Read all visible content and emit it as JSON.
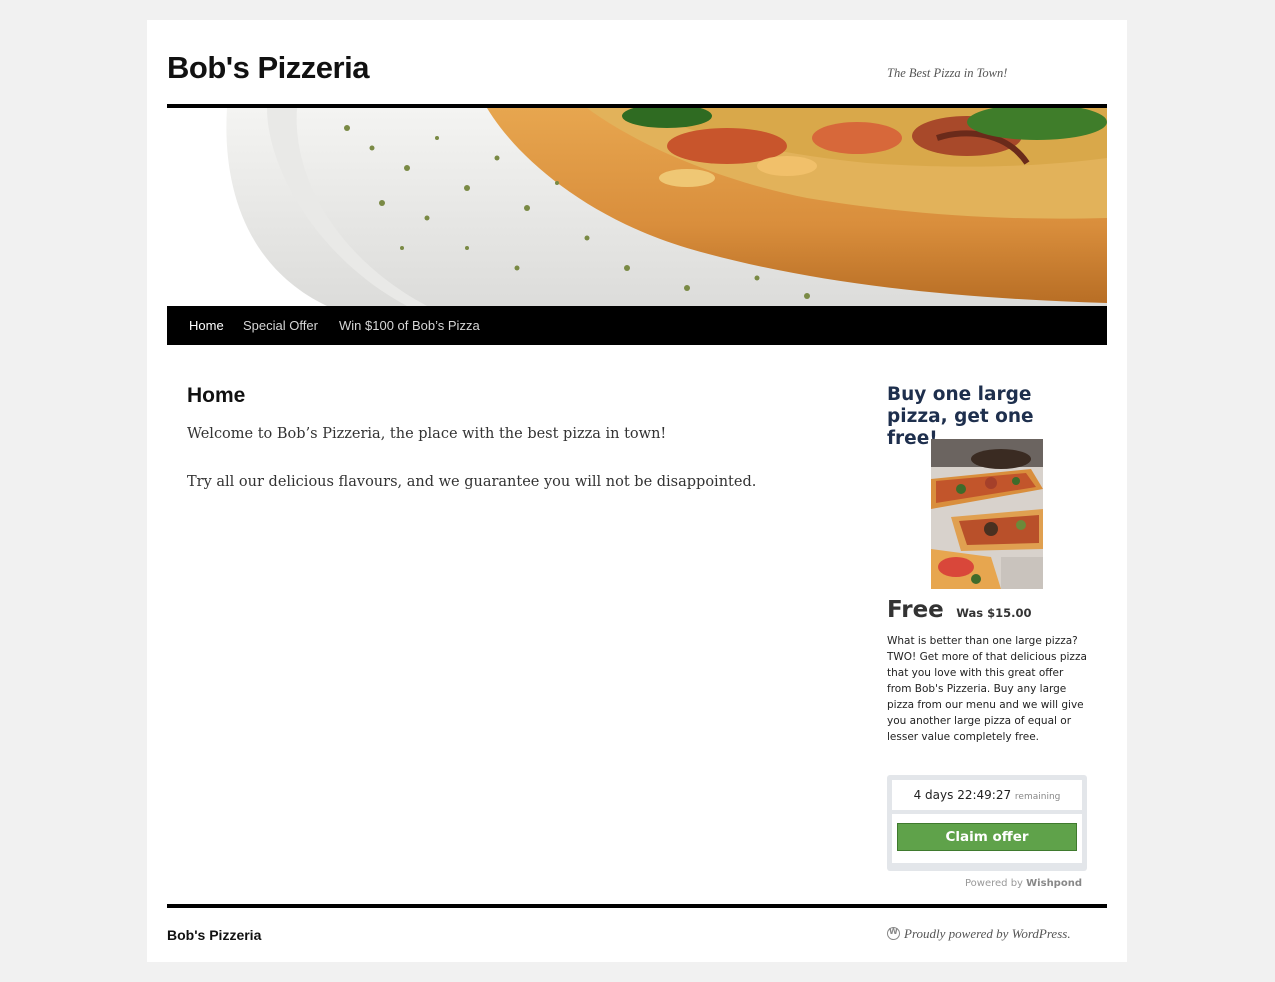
{
  "site": {
    "title": "Bob's Pizzeria",
    "description": "The Best Pizza in Town!"
  },
  "nav": {
    "items": [
      {
        "label": "Home",
        "current": true
      },
      {
        "label": "Special Offer",
        "current": false
      },
      {
        "label": "Win $100 of Bob’s Pizza",
        "current": false
      }
    ]
  },
  "entry": {
    "title": "Home",
    "paragraphs": [
      "Welcome to Bob’s Pizzeria, the place with the best pizza in town!",
      "Try all our delicious flavours, and we guarantee you will not be disappointed."
    ]
  },
  "offer": {
    "title": "Buy one large pizza, get one free!",
    "price": "Free",
    "was": "Was $15.00",
    "description": "What is better than one large pizza? TWO! Get more of that delicious pizza that you love with this great offer from Bob's Pizzeria. Buy any large pizza from our menu and we will give you another large pizza of equal or lesser value completely free.",
    "timer": "4 days 22:49:27",
    "timer_suffix": "remaining",
    "claim_label": "Claim offer",
    "powered_prefix": "Powered by",
    "powered_brand": "Wishpond",
    "button_color": "#5fa24a"
  },
  "footer": {
    "title": "Bob's Pizzeria",
    "credit": "Proudly powered by WordPress."
  }
}
